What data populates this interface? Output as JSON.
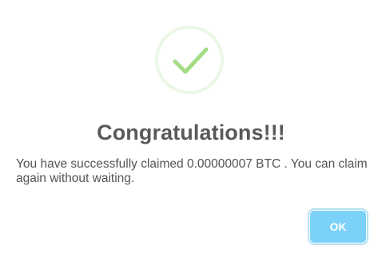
{
  "dialog": {
    "icon": "success-checkmark-icon",
    "title": "Congratulations!!!",
    "message": "You have successfully claimed 0.00000007 BTC . You can claim again without waiting.",
    "ok_label": "OK"
  },
  "colors": {
    "check": "#a5dc86",
    "ring": "rgba(165,220,134,0.2)",
    "button": "#7cd1f9",
    "title": "#595959",
    "text": "#545454"
  }
}
